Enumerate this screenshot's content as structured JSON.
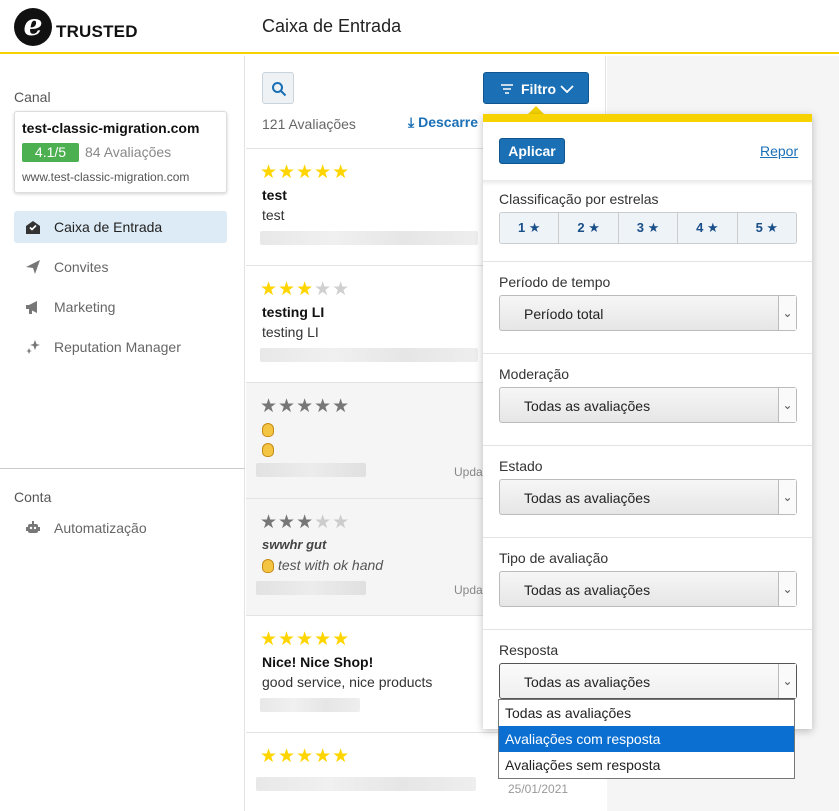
{
  "brand": {
    "logo_letter": "e",
    "name": "TRUSTED"
  },
  "header": {
    "title": "Caixa de Entrada"
  },
  "sidebar": {
    "channel_label": "Canal",
    "shop": {
      "name": "test-classic-migration.com",
      "rating": "4.1/5",
      "reviews": "84 Avaliações",
      "url": "www.test-classic-migration.com"
    },
    "items": [
      {
        "label": "Caixa de Entrada",
        "icon": "inbox-icon",
        "active": true
      },
      {
        "label": "Convites",
        "icon": "send-icon",
        "active": false
      },
      {
        "label": "Marketing",
        "icon": "megaphone-icon",
        "active": false
      },
      {
        "label": "Reputation Manager",
        "icon": "sparkles-icon",
        "active": false
      }
    ],
    "account_label": "Conta",
    "account_items": [
      {
        "label": "Automatização",
        "icon": "robot-icon"
      }
    ]
  },
  "toolbar": {
    "filter_label": "Filtro",
    "review_count": "121 Avaliações",
    "download_label": "Descarre"
  },
  "reviews": [
    {
      "stars": 5,
      "title": "test",
      "body": "test",
      "meta": ""
    },
    {
      "stars": 3,
      "title": "testing LI",
      "body": "testing LI",
      "meta": ""
    },
    {
      "stars": 5,
      "title": "",
      "body": "",
      "meta": "Updat"
    },
    {
      "stars": 3,
      "title": "swwhr gut",
      "body": "test with ok hand",
      "meta": "Updat"
    },
    {
      "stars": 5,
      "title": "Nice! Nice Shop!",
      "body": "good service, nice products",
      "meta": ""
    },
    {
      "stars": 5,
      "title": "",
      "body": "",
      "meta": "25/01/2021"
    }
  ],
  "filter": {
    "apply_label": "Aplicar",
    "reset_label": "Repor",
    "stars_label": "Classificação por estrelas",
    "star_options": [
      "1 ★",
      "2 ★",
      "3 ★",
      "4 ★",
      "5 ★"
    ],
    "period_label": "Período de tempo",
    "period_value": "Período total",
    "moderation_label": "Moderação",
    "moderation_value": "Todas as avaliações",
    "state_label": "Estado",
    "state_value": "Todas as avaliações",
    "type_label": "Tipo de avaliação",
    "type_value": "Todas as avaliações",
    "response_label": "Resposta",
    "response_value": "Todas as avaliações",
    "response_options": [
      "Todas as avaliações",
      "Avaliações com resposta",
      "Avaliações sem resposta"
    ],
    "response_highlighted": "Avaliações com resposta"
  },
  "colors": {
    "accent": "#1a6fb5",
    "brand_yellow": "#f5d200",
    "rating_green": "#4caf50",
    "star_yellow": "#ffd500"
  }
}
